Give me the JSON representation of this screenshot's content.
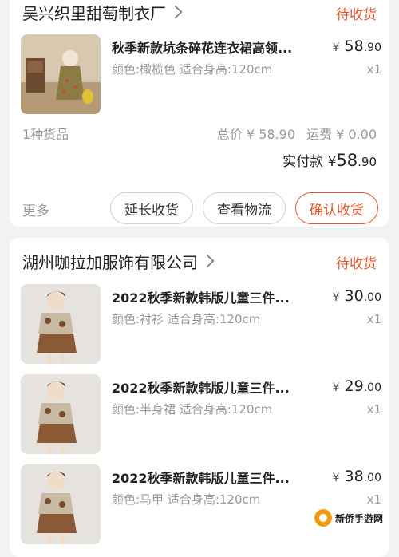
{
  "orders": [
    {
      "shop_name": "吴兴织里甜萄制衣厂",
      "status": "待收货",
      "items": [
        {
          "title": "秋季新款坑条碎花连衣裙高领...",
          "spec": "颜色:橄榄色  适合身高:120cm",
          "price_int": "58",
          "price_dec": ".90",
          "qty": "x1"
        }
      ],
      "count_text": "1种货品",
      "total_text": "总价 ¥ 58.90",
      "shipping_text": "运费 ¥ 0.00",
      "paid_label": "实付款 ¥",
      "paid_int": "58",
      "paid_dec": ".90",
      "more_label": "更多",
      "buttons": {
        "extend": "延长收货",
        "track": "查看物流",
        "confirm": "确认收货"
      }
    },
    {
      "shop_name": "湖州咖拉加服饰有限公司",
      "status": "待收货",
      "items": [
        {
          "title": "2022秋季新款韩版儿童三件...",
          "spec": "颜色:衬衫  适合身高:120cm",
          "price_int": "30",
          "price_dec": ".00",
          "qty": "x1"
        },
        {
          "title": "2022秋季新款韩版儿童三件...",
          "spec": "颜色:半身裙  适合身高:120cm",
          "price_int": "29",
          "price_dec": ".00",
          "qty": "x1"
        },
        {
          "title": "2022秋季新款韩版儿童三件...",
          "spec": "颜色:马甲  适合身高:120cm",
          "price_int": "38",
          "price_dec": ".00",
          "qty": "x1"
        }
      ]
    }
  ],
  "currency_symbol": "¥",
  "watermark_text": "新侨手游网",
  "colors": {
    "accent": "#e4572e",
    "muted": "#999999",
    "background": "#f2f2f2"
  }
}
